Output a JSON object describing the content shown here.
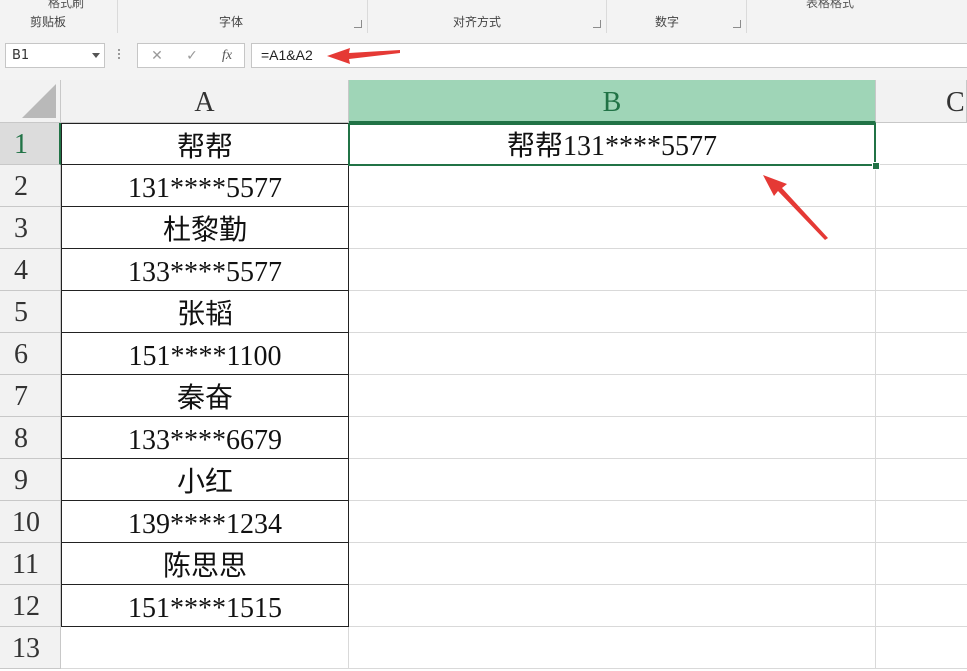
{
  "ribbon": {
    "groups": [
      "剪贴板",
      "字体",
      "对齐方式",
      "数字"
    ],
    "partial_button": "格式刷",
    "partial_style": "表格格式"
  },
  "formula_bar": {
    "name_box": "B1",
    "cancel_icon": "✕",
    "enter_icon": "✓",
    "fx_icon": "fx",
    "formula": "=A1&A2"
  },
  "sheet": {
    "columns": [
      "A",
      "B",
      "C"
    ],
    "selected_column": "B",
    "selected_row": "1",
    "rows": [
      {
        "num": "1",
        "a": "帮帮",
        "b": "帮帮131****5577"
      },
      {
        "num": "2",
        "a": "131****5577",
        "b": ""
      },
      {
        "num": "3",
        "a": "杜黎勤",
        "b": ""
      },
      {
        "num": "4",
        "a": "133****5577",
        "b": ""
      },
      {
        "num": "5",
        "a": "张韬",
        "b": ""
      },
      {
        "num": "6",
        "a": "151****1100",
        "b": ""
      },
      {
        "num": "7",
        "a": "秦奋",
        "b": ""
      },
      {
        "num": "8",
        "a": "133****6679",
        "b": ""
      },
      {
        "num": "9",
        "a": "小红",
        "b": ""
      },
      {
        "num": "10",
        "a": "139****1234",
        "b": ""
      },
      {
        "num": "11",
        "a": "陈思思",
        "b": ""
      },
      {
        "num": "12",
        "a": "151****1515",
        "b": ""
      },
      {
        "num": "13",
        "a": "",
        "b": ""
      }
    ]
  },
  "colors": {
    "accent": "#217346",
    "selected_header": "#9fd5b7",
    "annotation_arrow": "#e53935"
  }
}
